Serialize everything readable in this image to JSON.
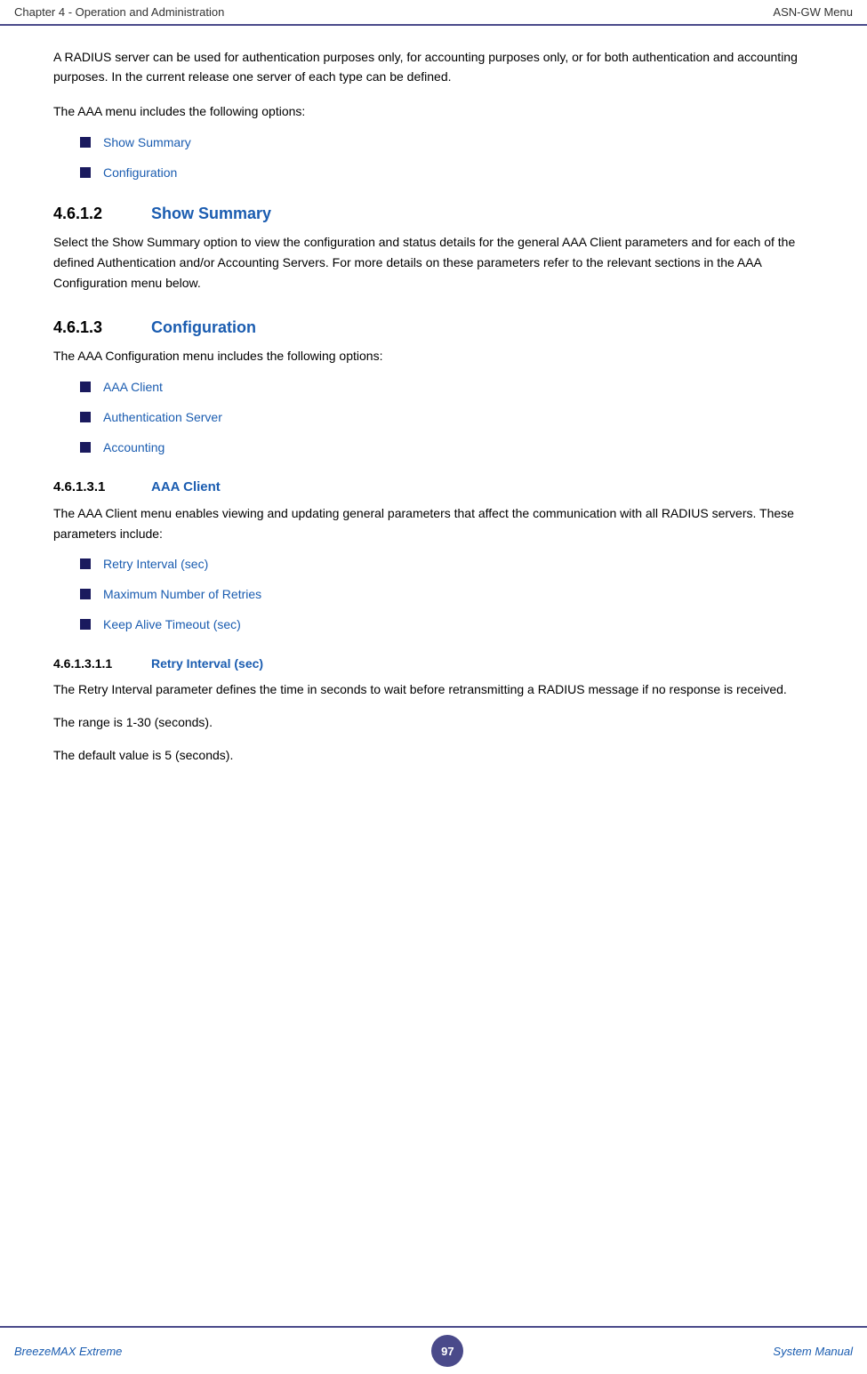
{
  "header": {
    "left": "Chapter 4 - Operation and Administration",
    "right": "ASN-GW Menu"
  },
  "intro": {
    "para1": "A RADIUS server can be used for authentication purposes only, for accounting purposes only, or for both authentication and accounting purposes. In the current release one server of each type can be defined.",
    "para2": "The AAA menu includes the following options:"
  },
  "top_bullets": [
    {
      "label": "Show Summary"
    },
    {
      "label": "Configuration"
    }
  ],
  "sections": [
    {
      "number": "4.6.1.2",
      "title": "Show Summary",
      "body": "Select the Show Summary option to view the configuration and status details for the general AAA Client parameters and for each of the defined Authentication and/or Accounting Servers. For more details on these parameters refer to the relevant sections in the AAA Configuration menu below."
    },
    {
      "number": "4.6.1.3",
      "title": "Configuration",
      "intro": "The AAA Configuration menu includes the following options:",
      "bullets": [
        {
          "label": "AAA Client"
        },
        {
          "label": "Authentication Server"
        },
        {
          "label": "Accounting"
        }
      ]
    },
    {
      "number": "4.6.1.3.1",
      "title": "AAA Client",
      "body": "The AAA Client menu enables viewing and updating general parameters that affect the communication with all RADIUS servers. These parameters include:",
      "bullets": [
        {
          "label": "Retry Interval (sec)"
        },
        {
          "label": "Maximum Number of Retries"
        },
        {
          "label": "Keep Alive Timeout (sec)"
        }
      ]
    },
    {
      "number": "4.6.1.3.1.1",
      "title": "Retry Interval (sec)",
      "body1": "The Retry Interval parameter defines the time in seconds to wait before retransmitting a RADIUS message if no response is received.",
      "body2": "The range is 1-30 (seconds).",
      "body3": "The default value is 5 (seconds)."
    }
  ],
  "footer": {
    "left": "BreezeMAX Extreme",
    "page": "97",
    "right": "System Manual"
  }
}
